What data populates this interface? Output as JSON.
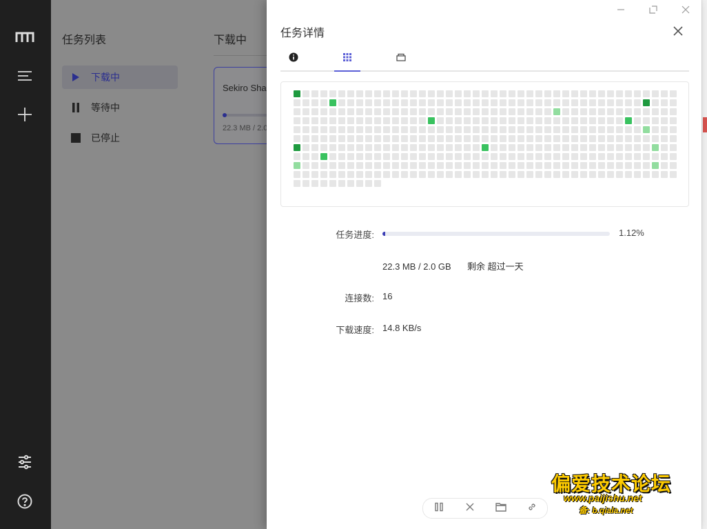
{
  "sidebar_nav": {
    "icons": [
      "logo-icon",
      "menu-icon",
      "add-icon",
      "settings-icon",
      "help-icon"
    ]
  },
  "task_list": {
    "title": "任务列表",
    "items": [
      {
        "label": "下载中",
        "icon": "play-icon"
      },
      {
        "label": "等待中",
        "icon": "pause-icon"
      },
      {
        "label": "已停止",
        "icon": "stop-icon"
      }
    ]
  },
  "content": {
    "title": "下载中",
    "task_card": {
      "name": "Sekiro Sha",
      "size": "22.3 MB / 2.0 GB"
    }
  },
  "drawer": {
    "title": "任务详情",
    "tabs": [
      {
        "icon": "info-icon"
      },
      {
        "icon": "grid-icon"
      },
      {
        "icon": "tray-icon"
      }
    ],
    "pieces": {
      "total": 440,
      "colors": {
        "empty": "#e6e6e6",
        "done_dark": "#1e9a3f",
        "done_mid": "#39c25f",
        "done_light": "#92dd9f"
      }
    },
    "progress": {
      "label": "任务进度:",
      "value": 0.0112,
      "percent_text": "1.12%"
    },
    "size_text": "22.3 MB / 2.0 GB",
    "remaining_text": "剩余 超过一天",
    "connections": {
      "label": "连接数:",
      "value": "16"
    },
    "speed": {
      "label": "下载速度:",
      "value": "14.8 KB/s"
    },
    "toolbar": [
      "pause-icon",
      "delete-icon",
      "folder-icon",
      "link-icon"
    ]
  },
  "watermark": {
    "line1": "偏爱技术论坛",
    "line2": "www.paijishu.net",
    "line3": "备: b.qiala.net"
  },
  "colors": {
    "accent": "#5b5fd6",
    "progress": "#3c3fb5",
    "rail": "#1f1f1f"
  }
}
